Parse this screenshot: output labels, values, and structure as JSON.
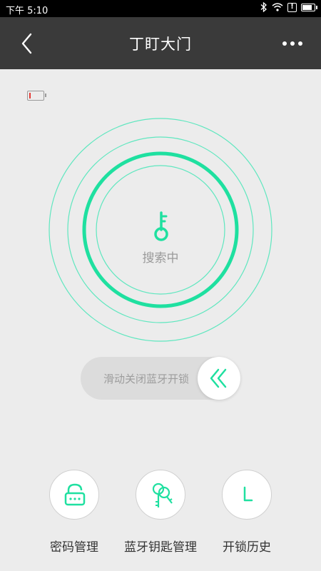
{
  "status_bar": {
    "time": "下午 5:10",
    "alert_badge": "!"
  },
  "header": {
    "title": "丁盯大门",
    "back_icon": "chevron-left-icon",
    "more_icon": "more-horizontal-icon"
  },
  "lock_battery": {
    "icon": "battery-icon",
    "level_percent": 10,
    "level_color": "#e53935"
  },
  "search": {
    "status_text": "搜索中",
    "icon": "key-icon"
  },
  "slider": {
    "text": "滑动关闭蓝牙开锁",
    "knob_icon": "double-chevron-left-icon"
  },
  "actions": [
    {
      "label": "密码管理",
      "icon": "password-lock-icon"
    },
    {
      "label": "蓝牙钥匙管理",
      "icon": "keys-icon"
    },
    {
      "label": "开锁历史",
      "icon": "history-clock-icon"
    }
  ],
  "colors": {
    "accent": "#1fe0a0",
    "header_bg": "#3a3a3a",
    "page_bg": "#ececec"
  }
}
